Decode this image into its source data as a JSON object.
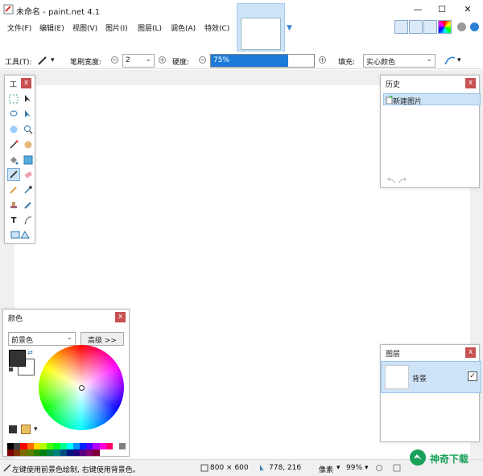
{
  "window": {
    "title": "未命名 - paint.net 4.1",
    "minimize": "—",
    "maximize": "☐",
    "close": "✕"
  },
  "menu": [
    {
      "label": "文件(F)"
    },
    {
      "label": "编辑(E)"
    },
    {
      "label": "视图(V)"
    },
    {
      "label": "图片(I)"
    },
    {
      "label": "图层(L)"
    },
    {
      "label": "调色(A)"
    },
    {
      "label": "特效(C)"
    }
  ],
  "toolbar2": {
    "tool_label": "工具(T):",
    "brush_width_label": "笔刷宽度:",
    "brush_width_value": "2",
    "hardness_label": "硬度:",
    "hardness_value": "75%",
    "hardness_fraction": 0.75,
    "fill_label": "填充:",
    "fill_value": "实心颜色"
  },
  "panels": {
    "tools": {
      "title": "工",
      "close": "x"
    },
    "history": {
      "title": "历史",
      "close": "x",
      "items": [
        {
          "label": "新建图片"
        }
      ]
    },
    "colors": {
      "title": "颜色",
      "close": "x",
      "mode": "前景色",
      "advanced": "高级 >>"
    },
    "layers": {
      "title": "图层",
      "close": "x",
      "items": [
        {
          "label": "背景",
          "checked": "✓"
        }
      ]
    }
  },
  "colors_palette": [
    "#000000",
    "#404040",
    "#ff0000",
    "#ff6a00",
    "#ffd800",
    "#b6ff00",
    "#4cff00",
    "#00ff21",
    "#00ff90",
    "#00ffff",
    "#0094ff",
    "#0026ff",
    "#4800ff",
    "#b200ff",
    "#ff00dc",
    "#ff006e",
    "#ffffff",
    "#808080",
    "#7f0000",
    "#7f3300",
    "#7f6a00",
    "#5b7f00",
    "#267f00",
    "#007f0e",
    "#007f46",
    "#007f7f",
    "#004a7f",
    "#00137f",
    "#21007f",
    "#57007f",
    "#7f006e",
    "#7f0037"
  ],
  "status": {
    "hint": "左键使用前景色绘制, 右键使用背景色。",
    "size": "800 × 600",
    "coords": "778, 216",
    "unit": "像素",
    "zoom": "99%"
  },
  "watermark": {
    "text": "神奇下载"
  },
  "accent": "#1c7bd8"
}
